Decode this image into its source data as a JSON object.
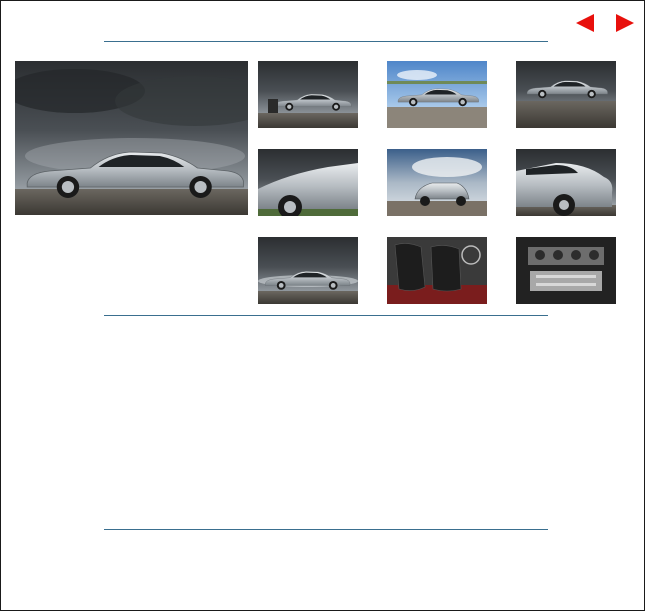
{
  "gallery": {
    "nav": {
      "prev_icon": "left-triangle-arrow-icon",
      "next_icon": "right-triangle-arrow-icon",
      "arrow_color": "#e8100c"
    },
    "main_photo": {
      "subject": "silver-coupe-side-profile"
    },
    "thumbnails": [
      {
        "id": "thumb-1",
        "subject": "coupe-front-three-quarter-storm-sky"
      },
      {
        "id": "thumb-2",
        "subject": "coupe-on-gravel-blue-sky"
      },
      {
        "id": "thumb-3",
        "subject": "coupe-side-storm-sky"
      },
      {
        "id": "thumb-4",
        "subject": "coupe-rear-fender-closeup"
      },
      {
        "id": "thumb-5",
        "subject": "coupe-front-view-cloudy"
      },
      {
        "id": "thumb-6",
        "subject": "coupe-rear-side-closeup"
      },
      {
        "id": "thumb-7",
        "subject": "coupe-side-low-angle"
      },
      {
        "id": "thumb-8",
        "subject": "black-leather-seats-interior"
      },
      {
        "id": "thumb-9",
        "subject": "v12-engine-bay"
      }
    ]
  }
}
